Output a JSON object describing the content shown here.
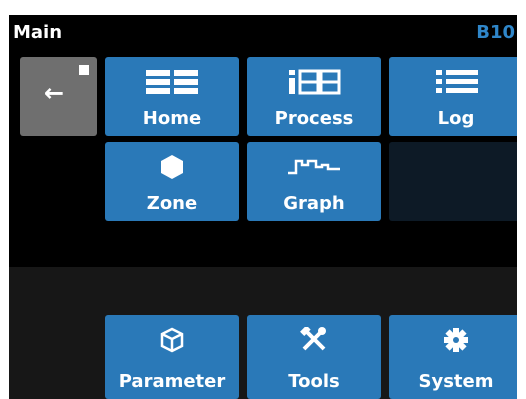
{
  "header": {
    "title": "Main",
    "code": "B10",
    "code_color": "#2f86c9"
  },
  "back_button": {
    "icon": "back-arrow-icon",
    "glyph": "←"
  },
  "tiles": [
    {
      "label": "Home",
      "icon": "home-grid-icon"
    },
    {
      "label": "Process",
      "icon": "process-icon"
    },
    {
      "label": "Log",
      "icon": "list-icon"
    },
    {
      "label": "Zone",
      "icon": "hexagon-icon"
    },
    {
      "label": "Graph",
      "icon": "waveform-icon"
    }
  ],
  "bottom_tiles": [
    {
      "label": "Parameter",
      "icon": "cube-icon"
    },
    {
      "label": "Tools",
      "icon": "tools-icon"
    },
    {
      "label": "System",
      "icon": "gear-icon"
    }
  ],
  "colors": {
    "tile": "#2a79b8",
    "back": "#6f6f6f",
    "background": "#000000"
  }
}
